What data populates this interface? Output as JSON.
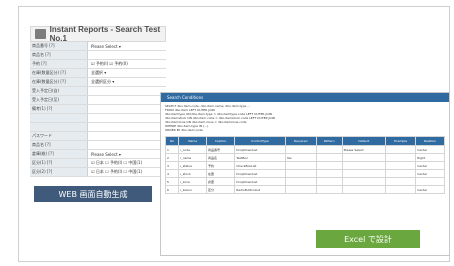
{
  "webform": {
    "title": "Instant Reports - Search Test No.1",
    "rows": [
      {
        "label": "商品番号 [?]",
        "value": "Please Select ▾"
      },
      {
        "label": "商品名 [?]",
        "value": ""
      },
      {
        "label": "予約 [?]",
        "value": "☑ 予約(I)  ☑ 予約(II)"
      },
      {
        "label": "在庫(数量区分) [?]",
        "value": "全選択 ▾"
      },
      {
        "label": "在庫(数量区分) [?]",
        "value": "全選択区分 ▾"
      },
      {
        "label": "受入予定日(自)",
        "value": ""
      },
      {
        "label": "受入予定日(至)",
        "value": ""
      },
      {
        "label": "備考(1) [?]",
        "value": ""
      },
      {
        "label": "",
        "value": ""
      },
      {
        "label": "",
        "value": ""
      },
      {
        "label": "パスワード",
        "value": ""
      },
      {
        "label": "商品名 [?]",
        "value": ""
      },
      {
        "label": "倉庫(総) [?]",
        "value": "Please Select ▾"
      },
      {
        "label": "区分(1) [?]",
        "value": "☑ 日本  ☐ 予約(I)  ☐ 中国(1)"
      },
      {
        "label": "区分(2) [?]",
        "value": "☑ 日本  ☐ 予約(I)  ☐ 中国(1)"
      }
    ],
    "caption": "WEB 画面自動生成"
  },
  "excel": {
    "title": "Search Conditions",
    "desc_lines": [
      "SELECT  dbo.item.code, dbo.item.name, dbo.item.type ...",
      "FROM  dbo.item LEFT OUTER JOIN",
      "dbo.itemtype ON dbo.item.type = dbo.itemtype.code LEFT OUTER JOIN",
      "dbo.itemstock ON dbo.item.code = dbo.itemstock.code LEFT OUTER JOIN",
      "dbo.itemzone ON dbo.item.zone = dbo.itemzone.code",
      "WHERE  dbo.item.type IN (...)",
      "ORDER BY  dbo.item.code"
    ],
    "table_headers": [
      "No",
      "Name",
      "Caption",
      "ControlType",
      "Required",
      "Pattern",
      "Default",
      "Example",
      "Relation"
    ],
    "table_rows": [
      [
        "1",
        "i_code",
        "商品番号",
        "DropDownList",
        "",
        "",
        "Please Select",
        "",
        "Center"
      ],
      [
        "2",
        "i_name",
        "商品名",
        "TextBox",
        "Yes",
        "",
        "",
        "",
        "Right"
      ],
      [
        "3",
        "i_status",
        "予約",
        "CheckBoxList",
        "",
        "",
        "",
        "",
        "Center"
      ],
      [
        "4",
        "i_stock",
        "在庫",
        "DropDownList",
        "",
        "",
        "",
        "",
        "Center"
      ],
      [
        "5",
        "i_zone",
        "倉庫",
        "DropDownList",
        "",
        "",
        "",
        "",
        ""
      ],
      [
        "6",
        "i_kubun",
        "区分",
        "RadioButtonList",
        "",
        "",
        "",
        "",
        "Center"
      ]
    ],
    "caption": "Excel で設計"
  }
}
